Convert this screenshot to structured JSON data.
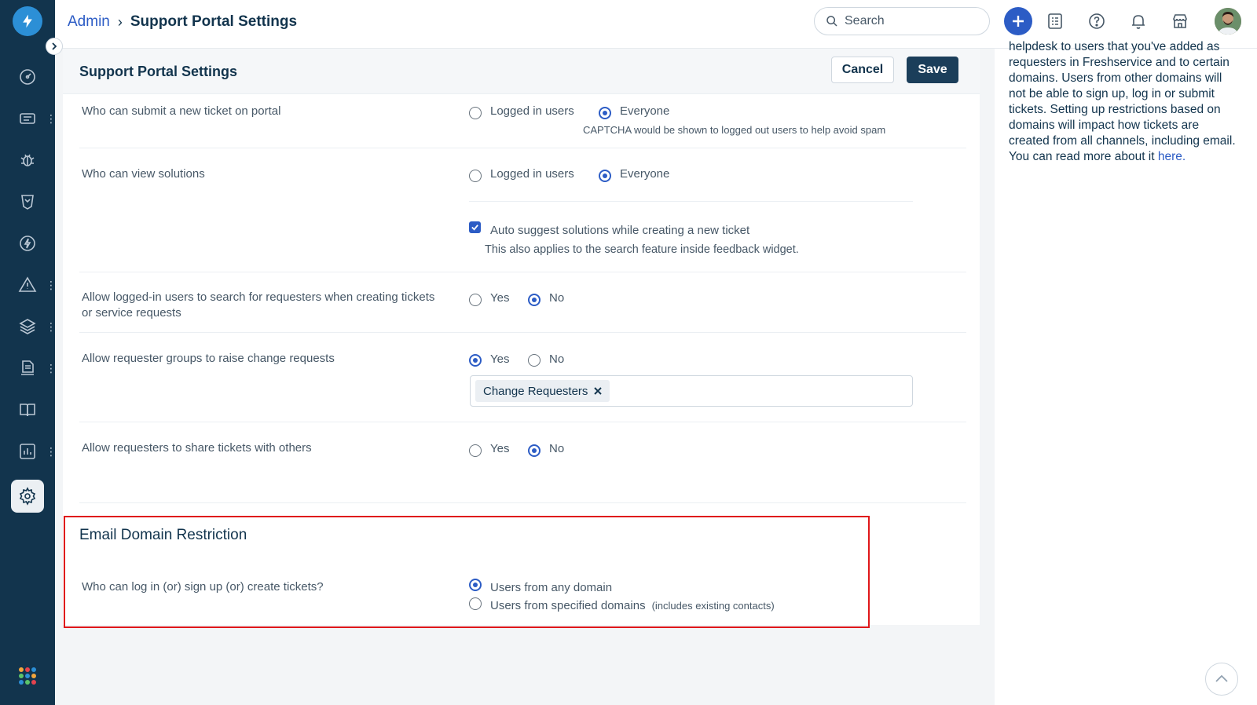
{
  "breadcrumb": {
    "parent": "Admin",
    "separator": "›",
    "current": "Support Portal Settings"
  },
  "search": {
    "placeholder": "Search"
  },
  "card": {
    "title": "Support Portal Settings",
    "cancel_label": "Cancel",
    "save_label": "Save"
  },
  "settings": {
    "submit_ticket": {
      "label": "Who can submit a new ticket on portal",
      "opt1": "Logged in users",
      "opt2": "Everyone",
      "selected": "Everyone",
      "hint": "CAPTCHA would be shown to logged out users to help avoid spam"
    },
    "view_solutions": {
      "label": "Who can view solutions",
      "opt1": "Logged in users",
      "opt2": "Everyone",
      "selected": "Everyone",
      "checkbox_label": "Auto suggest solutions while creating a new ticket",
      "checkbox_checked": true,
      "checkbox_hint": "This also applies to the search feature inside feedback widget."
    },
    "search_requesters": {
      "label": "Allow logged-in users to search for requesters when creating tickets or service requests",
      "opt1": "Yes",
      "opt2": "No",
      "selected": "No"
    },
    "change_requests": {
      "label": "Allow requester groups to raise change requests",
      "opt1": "Yes",
      "opt2": "No",
      "selected": "Yes",
      "tag": "Change Requesters"
    },
    "share_tickets": {
      "label": "Allow requesters to share tickets with others",
      "opt1": "Yes",
      "opt2": "No",
      "selected": "No"
    }
  },
  "email_domain": {
    "title": "Email Domain Restriction",
    "label": "Who can log in (or) sign up (or) create tickets?",
    "opt1": "Users from any domain",
    "opt2": "Users from specified domains",
    "opt2_note": "(includes existing contacts)",
    "selected": "Users from any domain"
  },
  "help": {
    "text": "helpdesk to users that you've added as requesters in Freshservice and to certain domains. Users from other domains will not be able to sign up, log in or submit tickets. Setting up restrictions based on domains will impact how tickets are created from all channels, including email. You can read more about it ",
    "link": "here."
  },
  "icons": {
    "logo": "lightning-logo-icon",
    "nav": [
      "dashboard-icon",
      "tickets-icon",
      "problems-icon",
      "changes-icon",
      "releases-icon",
      "alerts-icon",
      "assets-icon",
      "contracts-icon",
      "solutions-icon",
      "reports-icon",
      "admin-gear-icon"
    ],
    "header": [
      "search-icon",
      "plus-icon",
      "announcements-icon",
      "help-icon",
      "notifications-icon",
      "marketplace-icon",
      "avatar"
    ]
  },
  "colors": {
    "nav_bg": "#12344d",
    "accent": "#2c5cc5",
    "save_bg": "#1b3e5a",
    "highlight": "#e0171a"
  }
}
